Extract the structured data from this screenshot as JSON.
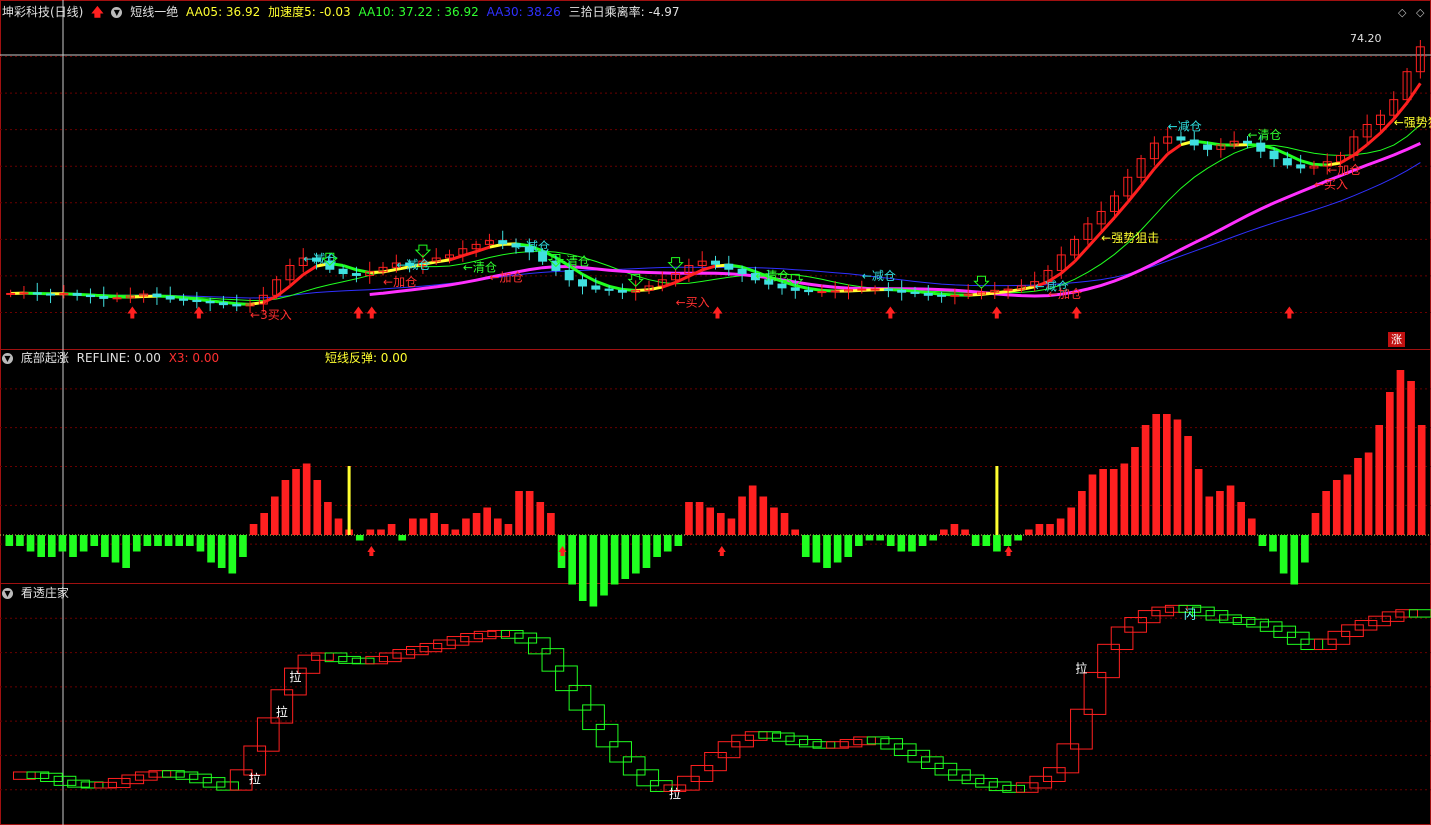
{
  "colors": {
    "bg": "#000000",
    "frame": "#a01010",
    "grid": "#6a0000",
    "up": "#ff2020",
    "down": "#40e0e0",
    "green": "#20ff20",
    "yellow": "#ffff30",
    "magenta": "#ff30ff",
    "blue": "#3030ff",
    "white": "#ffffff"
  },
  "main_header": {
    "stock": "坤彩科技(日线)",
    "indicator": "短线一绝",
    "aa05": "AA05: 36.92",
    "accel": "加速度5: -0.03",
    "aa10": "AA10: 37.22 : 36.92",
    "aa30": "AA30: 38.26",
    "dev": "三拾日乘离率: -4.97"
  },
  "panel2_header": {
    "name": "底部起涨",
    "refline": "REFLINE: 0.00",
    "x3": "X3: 0.00",
    "rebound": "短线反弹: 0.00"
  },
  "panel3_header": {
    "name": "看透庄家"
  },
  "price_label": "74.20",
  "zhang_badge": "涨",
  "chart_data": [
    {
      "type": "line",
      "panel": "price",
      "series": [
        {
          "values": [
            36.3,
            36.4,
            36.2,
            36.1,
            36.3,
            36.0,
            35.8,
            35.5,
            35.6,
            35.9,
            36.2,
            35.8,
            35.4,
            35.2,
            35.0,
            34.8,
            34.5,
            34.3,
            34.6,
            36.0,
            38.5,
            40.8,
            42.0,
            41.5,
            40.2,
            39.5,
            39.2,
            39.8,
            40.5,
            41.2,
            40.8,
            41.5,
            42.0,
            42.5,
            43.5,
            44.2,
            44.8,
            44.3,
            43.8,
            43.0,
            41.5,
            40.0,
            38.5,
            37.5,
            37.0,
            36.8,
            36.5,
            36.8,
            37.5,
            38.5,
            39.5,
            40.8,
            41.5,
            41.0,
            40.2,
            39.5,
            38.5,
            37.8,
            37.2,
            36.8,
            36.6,
            36.6,
            36.7,
            36.9,
            37.0,
            37.0,
            36.8,
            36.5,
            36.3,
            36.0,
            35.9,
            36.0,
            36.2,
            36.5,
            36.8,
            37.0,
            37.5,
            38.2,
            40.0,
            42.5,
            45.0,
            47.5,
            49.5,
            52.0,
            55.0,
            58.0,
            60.5,
            61.5,
            61.0,
            60.2,
            59.5,
            60.2,
            60.8,
            60.5,
            59.2,
            58.0,
            57.0,
            56.5,
            56.8,
            57.5,
            58.5,
            61.5,
            63.5,
            65.0,
            67.5,
            72.0,
            76.0
          ]
        }
      ],
      "x": []
    },
    {
      "type": "bar",
      "panel": "底部起涨",
      "values": [
        -2,
        -2,
        -3,
        -4,
        -4,
        -3,
        -4,
        -3,
        -2,
        -4,
        -5,
        -6,
        -3,
        -2,
        -2,
        -2,
        -2,
        -2,
        -3,
        -5,
        -6,
        -7,
        -4,
        2,
        4,
        7,
        10,
        12,
        13,
        10,
        6,
        3,
        1,
        -1,
        1,
        1,
        2,
        -1,
        3,
        3,
        4,
        2,
        1,
        3,
        4,
        5,
        3,
        2,
        8,
        8,
        6,
        4,
        -6,
        -9,
        -12,
        -13,
        -11,
        -9,
        -8,
        -7,
        -6,
        -4,
        -3,
        -2,
        6,
        6,
        5,
        4,
        3,
        7,
        9,
        7,
        5,
        4,
        1,
        -4,
        -5,
        -6,
        -5,
        -4,
        -2,
        -1,
        -1,
        -2,
        -3,
        -3,
        -2,
        -1,
        1,
        2,
        1,
        -2,
        -2,
        -3,
        -2,
        -1,
        1,
        2,
        2,
        3,
        5,
        8,
        11,
        12,
        12,
        13,
        16,
        20,
        22,
        22,
        21,
        18,
        12,
        7,
        8,
        9,
        6,
        3,
        -2,
        -3,
        -7,
        -9,
        -5,
        4,
        8,
        10,
        11,
        14,
        15,
        20,
        26,
        30,
        28,
        20
      ]
    },
    {
      "type": "line",
      "panel": "看透庄家",
      "values": [
        10,
        10.5,
        10.2,
        9.5,
        8.6,
        8.2,
        8.0,
        8.1,
        9.0,
        9.8,
        10.5,
        10.8,
        10.5,
        10.0,
        9.2,
        8.2,
        7.5,
        11.0,
        16.5,
        23.0,
        29.5,
        34.5,
        37.5,
        38.0,
        37.2,
        36.8,
        36.7,
        37.2,
        38.0,
        38.8,
        39.5,
        40.2,
        41.0,
        41.8,
        42.5,
        43.0,
        43.2,
        42.6,
        41.5,
        39.0,
        35.0,
        30.5,
        26.0,
        21.5,
        17.5,
        14.0,
        11.0,
        8.5,
        7.2,
        7.5,
        9.5,
        12.0,
        15.0,
        17.5,
        19.0,
        19.8,
        19.5,
        18.8,
        18.0,
        17.5,
        17.2,
        17.5,
        18.0,
        18.6,
        18.2,
        17.0,
        15.5,
        14.0,
        12.5,
        11.0,
        9.8,
        9.0,
        8.2,
        7.4,
        7.0,
        8.0,
        9.5,
        11.5,
        17.0,
        25.0,
        33.5,
        40.0,
        44.0,
        46.2,
        47.8,
        48.6,
        49.0,
        48.6,
        47.8,
        46.8,
        46.2,
        45.8,
        45.2,
        44.2,
        42.8,
        41.2,
        40.0,
        41.2,
        43.0,
        44.5,
        45.5,
        46.5,
        47.5,
        48.0,
        47.5
      ]
    }
  ],
  "annotations": {
    "main": [
      {
        "text": "←减仓",
        "c": "#30e0e0",
        "i": 22,
        "v": 41.2
      },
      {
        "text": "←减仓",
        "c": "#30e0e0",
        "i": 29,
        "v": 40.2
      },
      {
        "text": "←清仓",
        "c": "#30ff30",
        "i": 34,
        "v": 39.8
      },
      {
        "text": "←减仓",
        "c": "#30e0e0",
        "i": 38,
        "v": 43.2
      },
      {
        "text": "←清仓",
        "c": "#30ff30",
        "i": 41,
        "v": 40.8
      },
      {
        "text": "←加仓",
        "c": "#ff3030",
        "i": 28,
        "v": 37.5
      },
      {
        "text": "←加仓",
        "c": "#ff3030",
        "i": 36,
        "v": 38.2
      },
      {
        "text": "←买入",
        "c": "#ff3030",
        "i": 50,
        "v": 34.2
      },
      {
        "text": "←清仓",
        "c": "#30ff30",
        "i": 56,
        "v": 38.5
      },
      {
        "text": "←减仓",
        "c": "#30e0e0",
        "i": 64,
        "v": 38.5
      },
      {
        "text": "←减仓",
        "c": "#30e0e0",
        "i": 77,
        "v": 36.8
      },
      {
        "text": "←加仓",
        "c": "#ff3030",
        "i": 78,
        "v": 35.6
      },
      {
        "text": "←3买入",
        "c": "#ff3030",
        "i": 18,
        "v": 32.2
      },
      {
        "text": "←强势狙击",
        "c": "#ffff30",
        "i": 82,
        "v": 44.6
      },
      {
        "text": "←减仓",
        "c": "#30e0e0",
        "i": 87,
        "v": 62.5
      },
      {
        "text": "←清仓",
        "c": "#30ff30",
        "i": 93,
        "v": 61.2
      },
      {
        "text": "←加仓",
        "c": "#ff3030",
        "i": 99,
        "v": 55.5
      },
      {
        "text": "←买入",
        "c": "#ff3030",
        "i": 98,
        "v": 53.2
      },
      {
        "text": "←强势狙击",
        "c": "#ffff30",
        "i": 104,
        "v": 63.2
      }
    ],
    "lower": [
      {
        "text": "拉",
        "i": 18,
        "v": 9.5
      },
      {
        "text": "拉",
        "i": 20,
        "v": 25
      },
      {
        "text": "拉",
        "i": 21,
        "v": 33
      },
      {
        "text": "拉",
        "i": 49,
        "v": 6
      },
      {
        "text": "拉",
        "i": 79,
        "v": 35
      },
      {
        "text": "闪",
        "i": 87,
        "v": 47.5
      }
    ]
  }
}
